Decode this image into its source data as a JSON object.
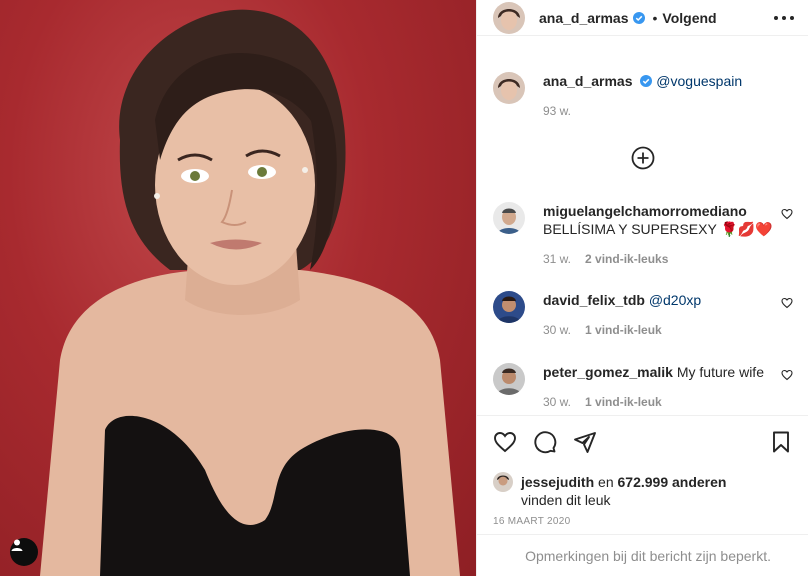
{
  "post": {
    "username": "ana_d_armas",
    "dot": "•",
    "follow_status": "Volgend",
    "caption_mention": "@voguespain",
    "caption_time": "93 w.",
    "date": "16 MAART 2020",
    "comments_restricted": "Opmerkingen bij dit bericht zijn beperkt."
  },
  "comments": [
    {
      "username": "miguelangelchamorromediano",
      "text": "BELLÍSIMA Y SUPERSEXY",
      "emoji": "🌹💋❤️",
      "time": "31 w.",
      "likes": "2 vind-ik-leuks"
    },
    {
      "username": "david_felix_tdb",
      "text": "@d20xp",
      "time": "30 w.",
      "likes": "1 vind-ik-leuk"
    },
    {
      "username": "peter_gomez_malik",
      "text": "My future wife",
      "time": "30 w.",
      "likes": "1 vind-ik-leuk"
    }
  ],
  "likes": {
    "user": "jessejudith",
    "connector": "en",
    "count": "672.999 anderen",
    "suffix": "vinden dit leuk"
  },
  "icons": {
    "like": "heart-icon",
    "comment": "comment-icon",
    "share": "paper-plane-icon",
    "save": "bookmark-icon",
    "more": "more-dots-icon",
    "load_more": "plus-circle-icon",
    "verified": "verified-badge-icon",
    "tagged": "user-tag-icon"
  },
  "colors": {
    "verified": "#3897f0",
    "mention": "#00376b",
    "muted": "#8e8e8e",
    "background": "#a82a2f"
  }
}
